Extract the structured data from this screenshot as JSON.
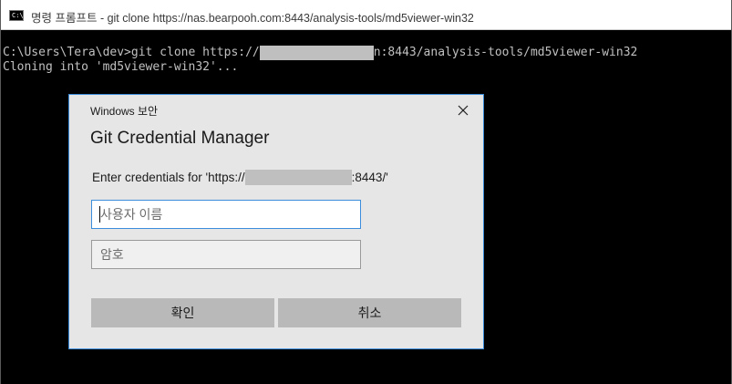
{
  "window": {
    "title": "명령 프롬프트 - git  clone https://nas.bearpooh.com:8443/analysis-tools/md5viewer-win32",
    "icon": "cmd-icon"
  },
  "console": {
    "line1_prefix": "C:\\Users\\Tera\\dev>git clone https://",
    "line1_suffix": "n:8443/analysis-tools/md5viewer-win32",
    "line2": "Cloning into 'md5viewer-win32'..."
  },
  "dialog": {
    "caption": "Windows 보안",
    "title": "Git Credential Manager",
    "prompt_prefix": "Enter credentials for 'https://",
    "prompt_suffix": ":8443/'",
    "username_placeholder": "사용자 이름",
    "username_value": "",
    "password_placeholder": "암호",
    "password_value": "",
    "ok_label": "확인",
    "cancel_label": "취소",
    "close_icon": "close-icon"
  },
  "colors": {
    "console_bg": "#000000",
    "console_text": "#c0c0c0",
    "dialog_bg": "#e6e6e6",
    "accent_border": "#3c8ddc",
    "button_bg": "#b9b9b9",
    "redaction": "#bfbfbf"
  }
}
